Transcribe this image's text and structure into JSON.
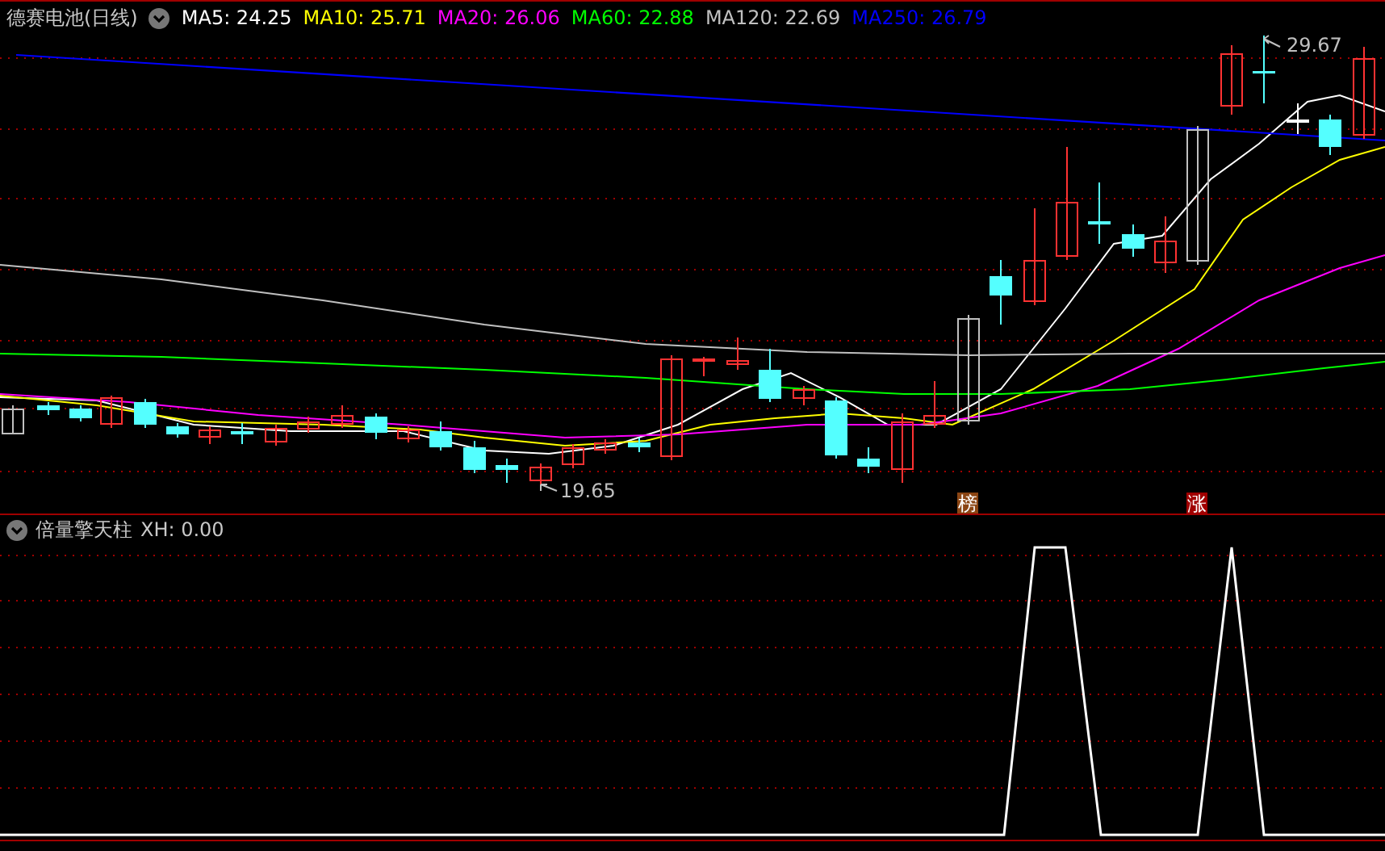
{
  "main_panel": {
    "title": "德赛电池(日线)",
    "indicators": [
      {
        "label": "MA5: 24.25",
        "color": "#ffffff"
      },
      {
        "label": "MA10: 25.71",
        "color": "#ffff00"
      },
      {
        "label": "MA20: 26.06",
        "color": "#ff00ff"
      },
      {
        "label": "MA60: 22.88",
        "color": "#00ff00"
      },
      {
        "label": "MA120: 22.69",
        "color": "#c0c0c0"
      },
      {
        "label": "MA250: 26.79",
        "color": "#0000ff"
      }
    ],
    "annotations": [
      {
        "kind": "high",
        "label": "29.67"
      },
      {
        "kind": "low",
        "label": "19.65"
      }
    ],
    "markers": [
      {
        "label": "榜",
        "color": "#8b4513"
      },
      {
        "label": "涨",
        "color": "#a00000"
      }
    ]
  },
  "indicator_panel": {
    "title": "倍量擎天柱",
    "reading": "XH: 0.00"
  }
}
